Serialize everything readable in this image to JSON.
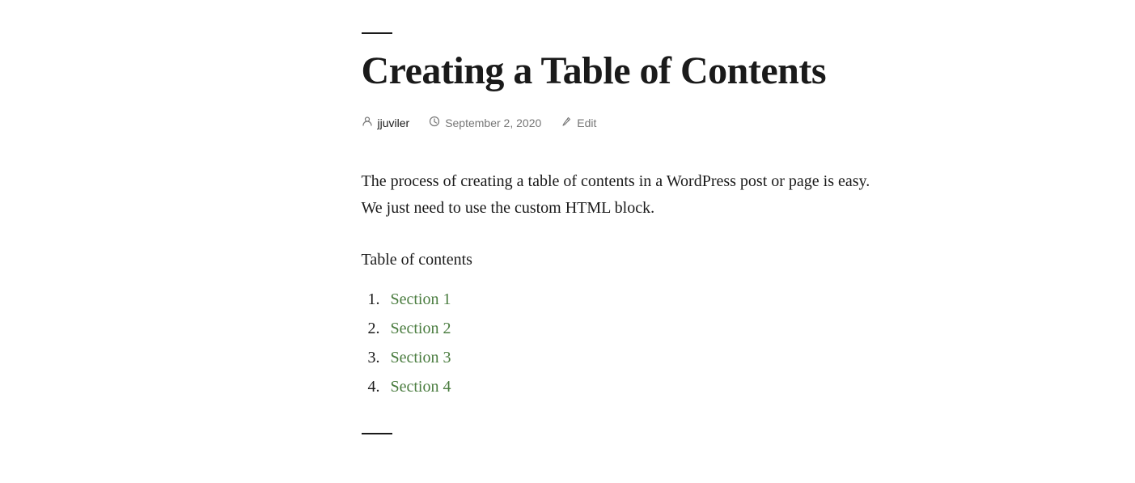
{
  "page": {
    "top_divider": true,
    "title": "Creating a Table of Contents",
    "meta": {
      "author_icon": "person-icon",
      "author": "jjuviler",
      "date_icon": "clock-icon",
      "date": "September 2, 2020",
      "edit_icon": "pencil-icon",
      "edit_label": "Edit"
    },
    "body_text": "The process of creating a table of contents in a WordPress post or page is easy. We just need to use the custom HTML block.",
    "toc": {
      "heading": "Table of contents",
      "items": [
        {
          "number": "1.",
          "label": "Section 1",
          "href": "#section-1"
        },
        {
          "number": "2.",
          "label": "Section 2",
          "href": "#section-2"
        },
        {
          "number": "3.",
          "label": "Section 3",
          "href": "#section-3"
        },
        {
          "number": "4.",
          "label": "Section 4",
          "href": "#section-4"
        }
      ]
    },
    "bottom_divider": true
  },
  "colors": {
    "link": "#4a7c3f",
    "text": "#1a1a1a",
    "meta": "#767676"
  }
}
